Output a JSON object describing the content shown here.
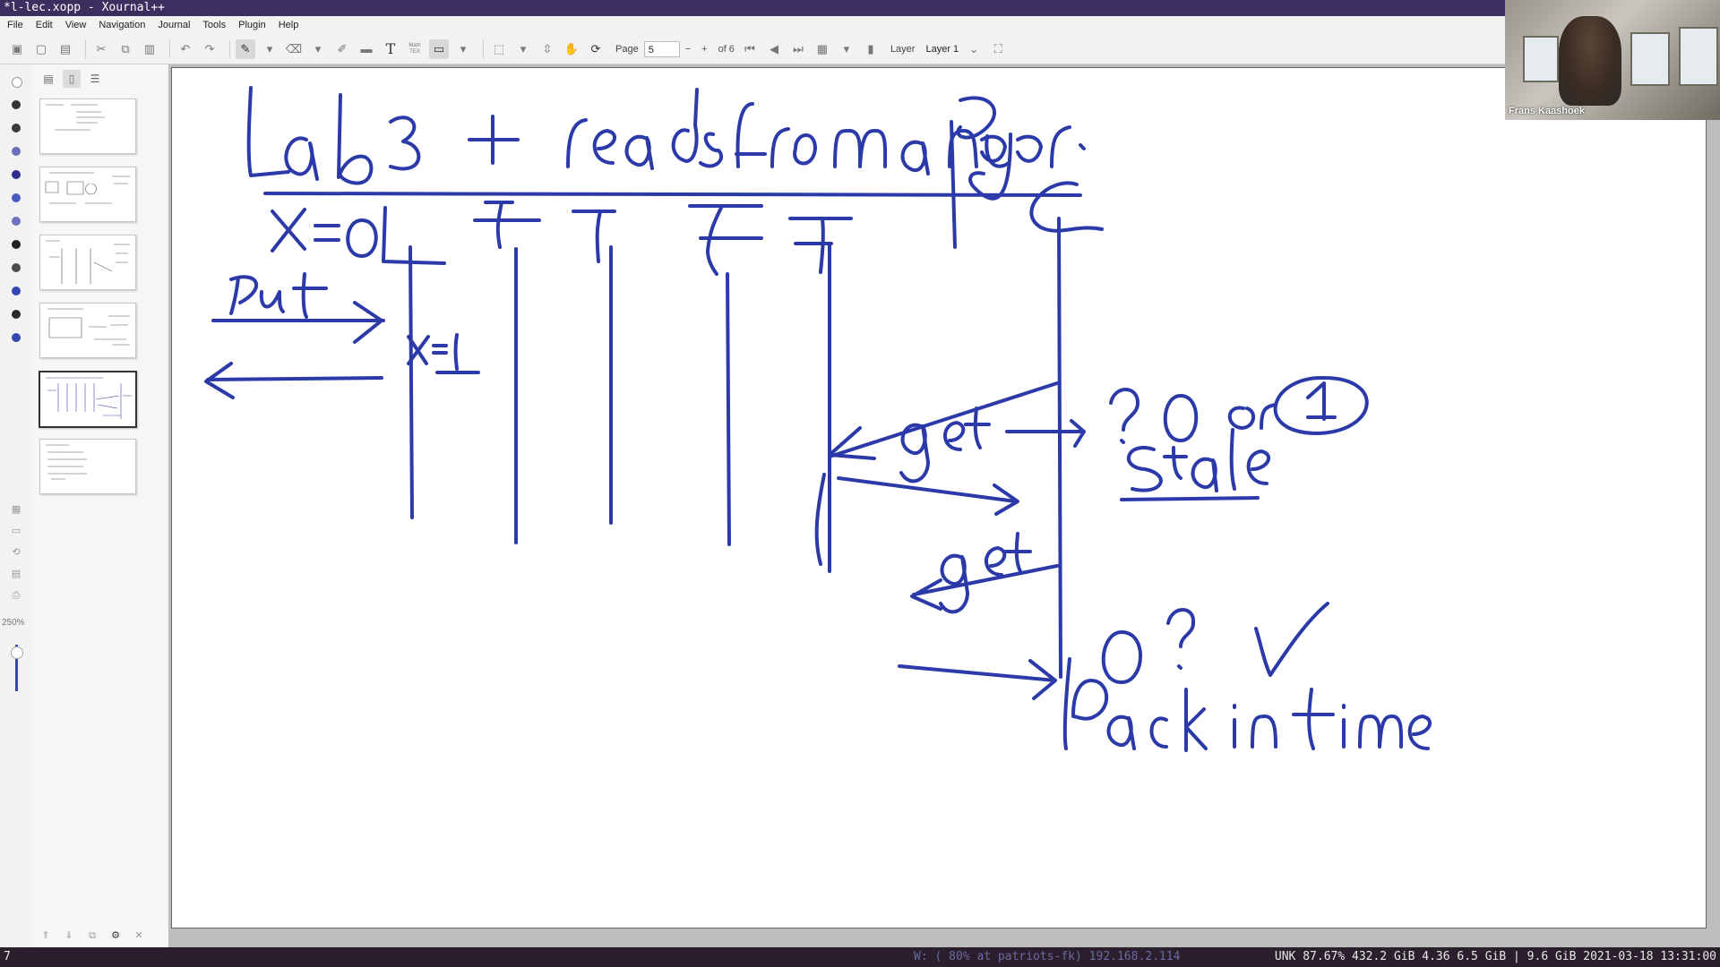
{
  "window": {
    "title": "*l-lec.xopp - Xournal++"
  },
  "menu": [
    "File",
    "Edit",
    "View",
    "Navigation",
    "Journal",
    "Tools",
    "Plugin",
    "Help"
  ],
  "toolbar": {
    "page_label": "Page",
    "page_value": "5",
    "page_total": "of 6",
    "layer_label": "Layer",
    "layer_value": "Layer 1",
    "text_tool": "T",
    "tex_tool": "Math TEX"
  },
  "palette": {
    "colors": [
      "#ffffff",
      "#333333",
      "#3b3b3b",
      "#6a70b8",
      "#2e2e8a",
      "#4a5ac0",
      "#7070c0",
      "#222222",
      "#4b4b4b",
      "#3745b3",
      "#2a2a2a",
      "#3548b0"
    ],
    "zoom": "250%"
  },
  "webcam": {
    "name": "Frans Kaashoek"
  },
  "slide": {
    "title": "Lab 3 + reads from any peer",
    "labels": [
      "X=0",
      "put",
      "x=1",
      "get",
      "? 0 or 1",
      "stale",
      "get",
      "0?",
      "back in time"
    ],
    "ink_color": "#2b3aa8"
  },
  "statusbar": {
    "workspace": "7",
    "network": "W: ( 80% at patriots-fk) 192.168.2.114",
    "right": "UNK 87.67% 432.2 GiB 4.36 6.5 GiB | 9.6 GiB 2021-03-18 13:31:00"
  }
}
